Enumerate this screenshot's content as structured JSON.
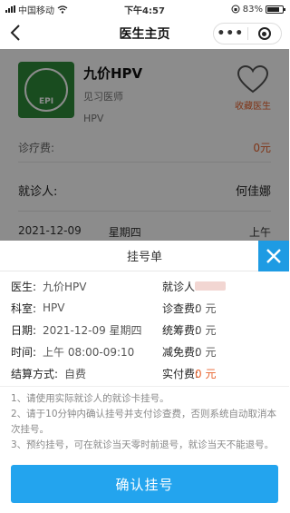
{
  "status_bar": {
    "carrier": "中国移动",
    "time": "下午4:57",
    "battery": "83%"
  },
  "nav": {
    "title": "医生主页"
  },
  "doctor": {
    "name": "九价HPV",
    "title": "见习医师",
    "department": "HPV",
    "favorite_label": "收藏医生",
    "photo_text": "EPI"
  },
  "background": {
    "fee_label": "诊疗费:",
    "fee_value": "0元",
    "patient_label": "就诊人:",
    "patient_value": "何佳娜",
    "date": "2021-12-09",
    "weekday": "星期四",
    "period": "上午"
  },
  "sheet": {
    "title": "挂号单",
    "left_rows": [
      {
        "label": "医生:",
        "value": "九价HPV"
      },
      {
        "label": "科室:",
        "value": "HPV"
      },
      {
        "label": "日期:",
        "value": "2021-12-09 星期四"
      },
      {
        "label": "时间:",
        "value": "上午 08:00-09:10"
      },
      {
        "label": "结算方式:",
        "value": "自费"
      }
    ],
    "right_rows": [
      {
        "label": "就诊人:",
        "value": ""
      },
      {
        "label": "诊查费:",
        "value": "0 元"
      },
      {
        "label": "统筹费:",
        "value": "0 元"
      },
      {
        "label": "减免费:",
        "value": "0 元"
      },
      {
        "label": "实付费:",
        "value": "0 元"
      }
    ],
    "notes": [
      "1、请使用实际就诊人的就诊卡挂号。",
      "2、请于10分钟内确认挂号并支付诊查费，否则系统自动取消本次挂号。",
      "3、预约挂号，可在就诊当天零时前退号，就诊当天不能退号。"
    ],
    "confirm_label": "确认挂号"
  },
  "colors": {
    "accent": "#23a4ee",
    "close": "#1e9be3",
    "orange": "#e8622c"
  }
}
